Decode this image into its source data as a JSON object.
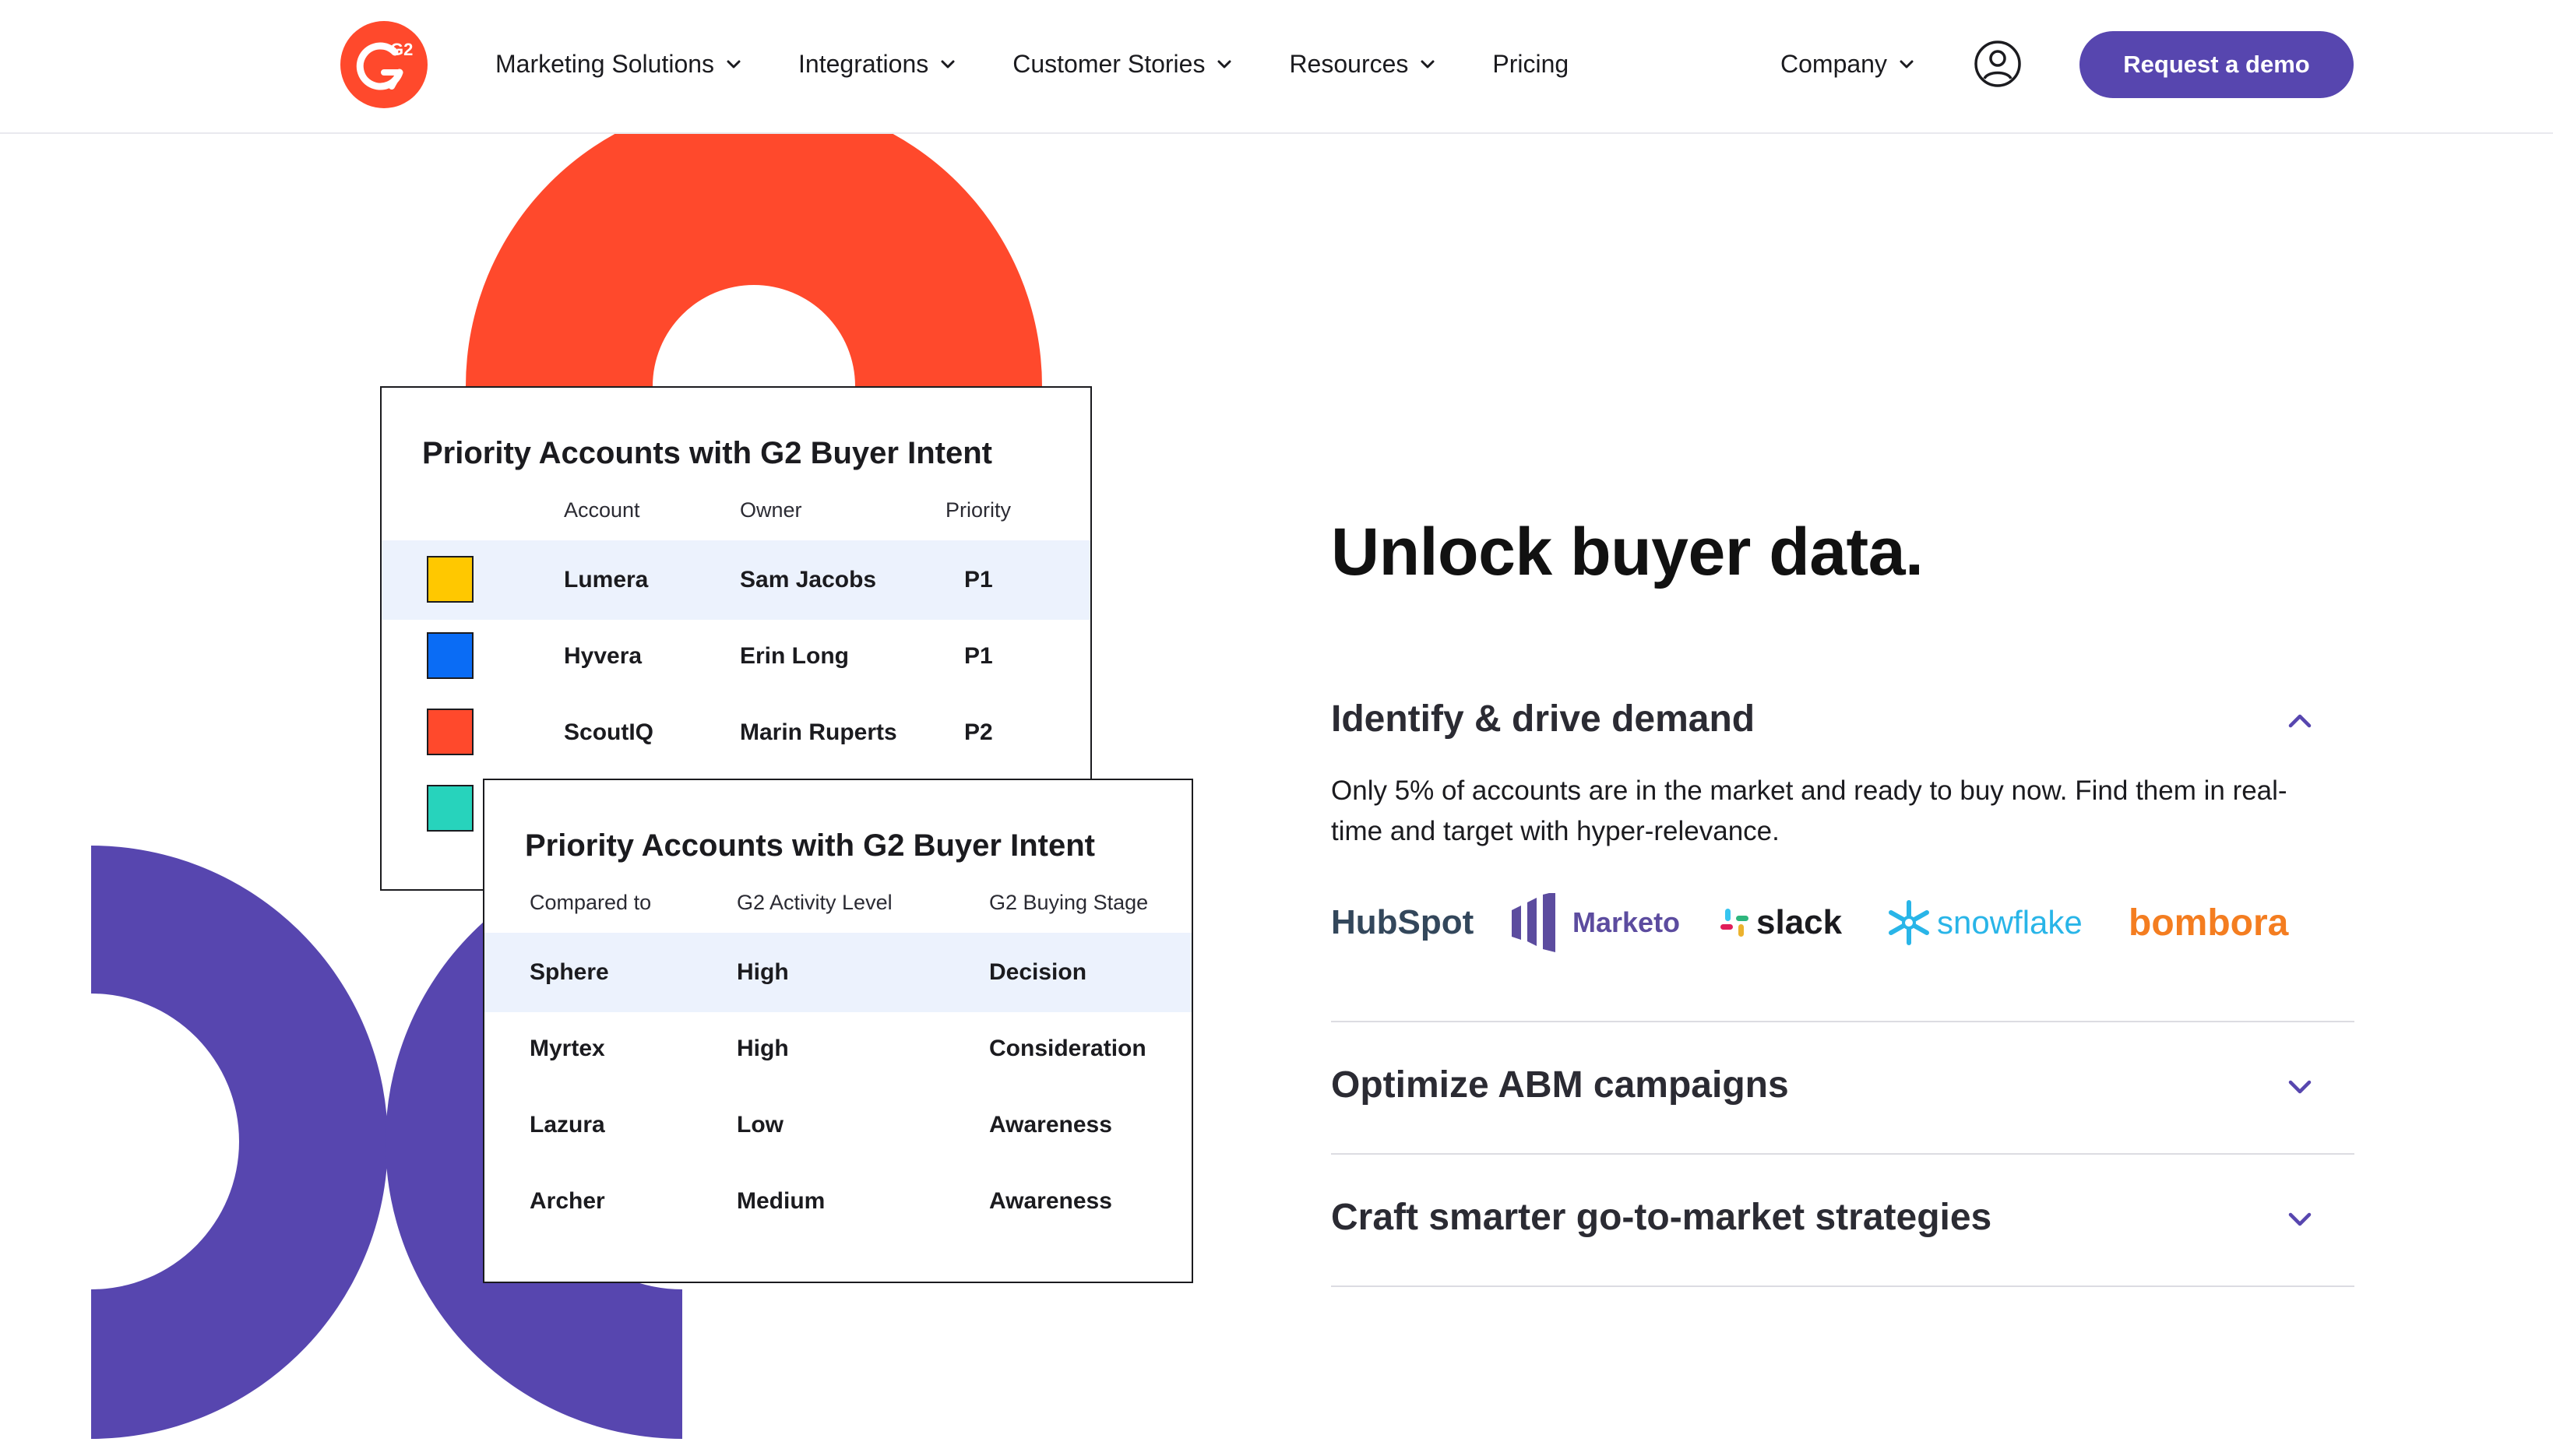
{
  "header": {
    "logo_text": "G2",
    "nav": [
      {
        "label": "Marketing Solutions",
        "has_dropdown": true
      },
      {
        "label": "Integrations",
        "has_dropdown": true
      },
      {
        "label": "Customer Stories",
        "has_dropdown": true
      },
      {
        "label": "Resources",
        "has_dropdown": true
      },
      {
        "label": "Pricing",
        "has_dropdown": false
      }
    ],
    "company": {
      "label": "Company",
      "has_dropdown": true
    },
    "user_icon": "user-circle-icon",
    "cta_label": "Request a demo"
  },
  "colors": {
    "brand_red": "#ff492c",
    "brand_purple": "#5746af",
    "row_highlight": "#ecf2fd"
  },
  "card1": {
    "title": "Priority Accounts with G2 Buyer Intent",
    "columns": [
      "Account",
      "Owner",
      "Priority"
    ],
    "rows": [
      {
        "swatch": "#ffc800",
        "account": "Lumera",
        "owner": "Sam Jacobs",
        "priority": "P1",
        "highlight": true
      },
      {
        "swatch": "#0a6cf5",
        "account": "Hyvera",
        "owner": "Erin Long",
        "priority": "P1",
        "highlight": false
      },
      {
        "swatch": "#ff492c",
        "account": "ScoutIQ",
        "owner": "Marin Ruperts",
        "priority": "P2",
        "highlight": false
      },
      {
        "swatch": "#27d3bc",
        "account": "",
        "owner": "",
        "priority": "",
        "highlight": false
      }
    ]
  },
  "card2": {
    "title": "Priority Accounts with G2 Buyer Intent",
    "columns": [
      "Compared to",
      "G2 Activity Level",
      "G2 Buying Stage"
    ],
    "rows": [
      {
        "compared": "Sphere",
        "activity": "High",
        "stage": "Decision",
        "highlight": true
      },
      {
        "compared": "Myrtex",
        "activity": "High",
        "stage": "Consideration",
        "highlight": false
      },
      {
        "compared": "Lazura",
        "activity": "Low",
        "stage": "Awareness",
        "highlight": false
      },
      {
        "compared": "Archer",
        "activity": "Medium",
        "stage": "Awareness",
        "highlight": false
      }
    ]
  },
  "main": {
    "headline": "Unlock buyer data.",
    "accordion": [
      {
        "title": "Identify & drive demand",
        "expanded": true,
        "body": "Only 5% of accounts are in the market and ready to buy now. Find them in real-time and target with hyper-relevance."
      },
      {
        "title": "Optimize ABM campaigns",
        "expanded": false
      },
      {
        "title": "Craft smarter go-to-market strategies",
        "expanded": false
      }
    ],
    "partner_logos": [
      "HubSpot",
      "Marketo",
      "slack",
      "snowflake",
      "bombora"
    ]
  }
}
